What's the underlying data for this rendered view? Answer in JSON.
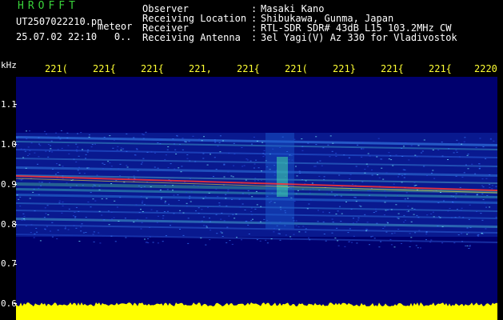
{
  "header": {
    "brand": "HROFFT",
    "file_name": "UT2507022210.pn",
    "mode": "meteor",
    "date_time": "25.07.02 22:10",
    "counter": "0.."
  },
  "info": [
    {
      "key": "Observer",
      "value": "Masaki Kano"
    },
    {
      "key": "Receiving Location",
      "value": "Shibukawa, Gunma, Japan"
    },
    {
      "key": "Receiver",
      "value": "RTL-SDR SDR# 43dB L15 103.2MHz CW"
    },
    {
      "key": "Receiving Antenna",
      "value": "3el Yagi(V) Az 330 for Vladivostok"
    }
  ],
  "axis": {
    "unit": "kHz",
    "time_ticks": [
      "221(",
      "221{",
      "221{",
      "221,",
      "221{",
      "221(",
      "221}",
      "221{",
      "221{",
      "2220"
    ],
    "freq_ticks": [
      "1.1",
      "1.0",
      "0.9",
      "0.8",
      "0.7",
      "0.6"
    ]
  },
  "colors": {
    "background": "#000000",
    "brand": "#39d23a",
    "tick_top": "#ffff33",
    "noise_bar": "#ffff00",
    "signal_line": "#ff3333"
  }
}
